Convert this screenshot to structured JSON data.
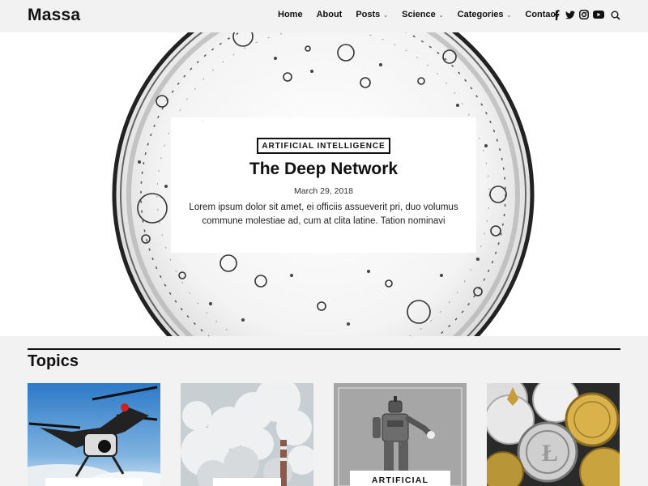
{
  "header": {
    "logo": "Massa",
    "nav": [
      {
        "label": "Home",
        "has_dropdown": false
      },
      {
        "label": "About",
        "has_dropdown": false
      },
      {
        "label": "Posts",
        "has_dropdown": true
      },
      {
        "label": "Science",
        "has_dropdown": true
      },
      {
        "label": "Categories",
        "has_dropdown": true
      },
      {
        "label": "Contact",
        "has_dropdown": false
      }
    ],
    "social_icons": [
      "facebook-icon",
      "twitter-icon",
      "instagram-icon",
      "youtube-icon"
    ],
    "search_icon": "search-icon"
  },
  "hero": {
    "category": "ARTIFICIAL INTELLIGENCE",
    "title": "The Deep Network",
    "date": "March 29, 2018",
    "excerpt": "Lorem ipsum dolor sit amet, ei officiis assueverit pri, duo volumus commune molestiae ad, cum at clita latine. Tation nominavi"
  },
  "topics": {
    "heading": "Topics",
    "cards": [
      {
        "label": "",
        "image": "drone"
      },
      {
        "label": "",
        "image": "smokestack"
      },
      {
        "label": "ARTIFICIAL",
        "image": "robot"
      },
      {
        "label": "",
        "image": "coins"
      }
    ]
  },
  "colors": {
    "background": "#f2f2f2",
    "text": "#111111",
    "card": "#ffffff"
  }
}
